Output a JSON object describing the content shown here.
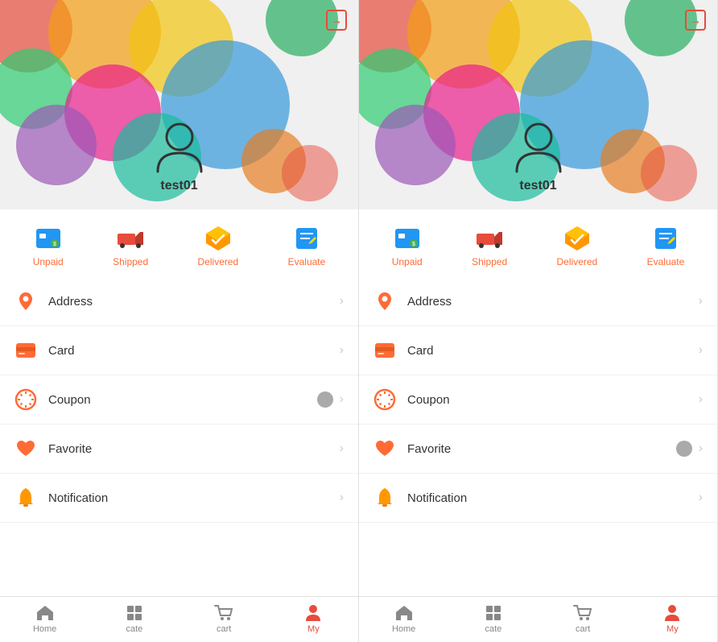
{
  "panels": [
    {
      "id": "left",
      "username": "test01",
      "order_labels": [
        "Unpaid",
        "Shipped",
        "Delivered",
        "Evaluate"
      ],
      "menu_items": [
        {
          "id": "address",
          "label": "Address",
          "has_badge": false
        },
        {
          "id": "card",
          "label": "Card",
          "has_badge": false
        },
        {
          "id": "coupon",
          "label": "Coupon",
          "has_badge": true
        },
        {
          "id": "favorite",
          "label": "Favorite",
          "has_badge": false
        },
        {
          "id": "notification",
          "label": "Notification",
          "has_badge": false
        }
      ],
      "nav_items": [
        "Home",
        "cate",
        "cart",
        "My"
      ],
      "active_nav": 3
    },
    {
      "id": "right",
      "username": "test01",
      "order_labels": [
        "Unpaid",
        "Shipped",
        "Delivered",
        "Evaluate"
      ],
      "menu_items": [
        {
          "id": "address",
          "label": "Address",
          "has_badge": false
        },
        {
          "id": "card",
          "label": "Card",
          "has_badge": false
        },
        {
          "id": "coupon",
          "label": "Coupon",
          "has_badge": false
        },
        {
          "id": "favorite",
          "label": "Favorite",
          "has_badge": true
        },
        {
          "id": "notification",
          "label": "Notification",
          "has_badge": false
        }
      ],
      "nav_items": [
        "Home",
        "cate",
        "cart",
        "My"
      ],
      "active_nav": 3
    }
  ]
}
